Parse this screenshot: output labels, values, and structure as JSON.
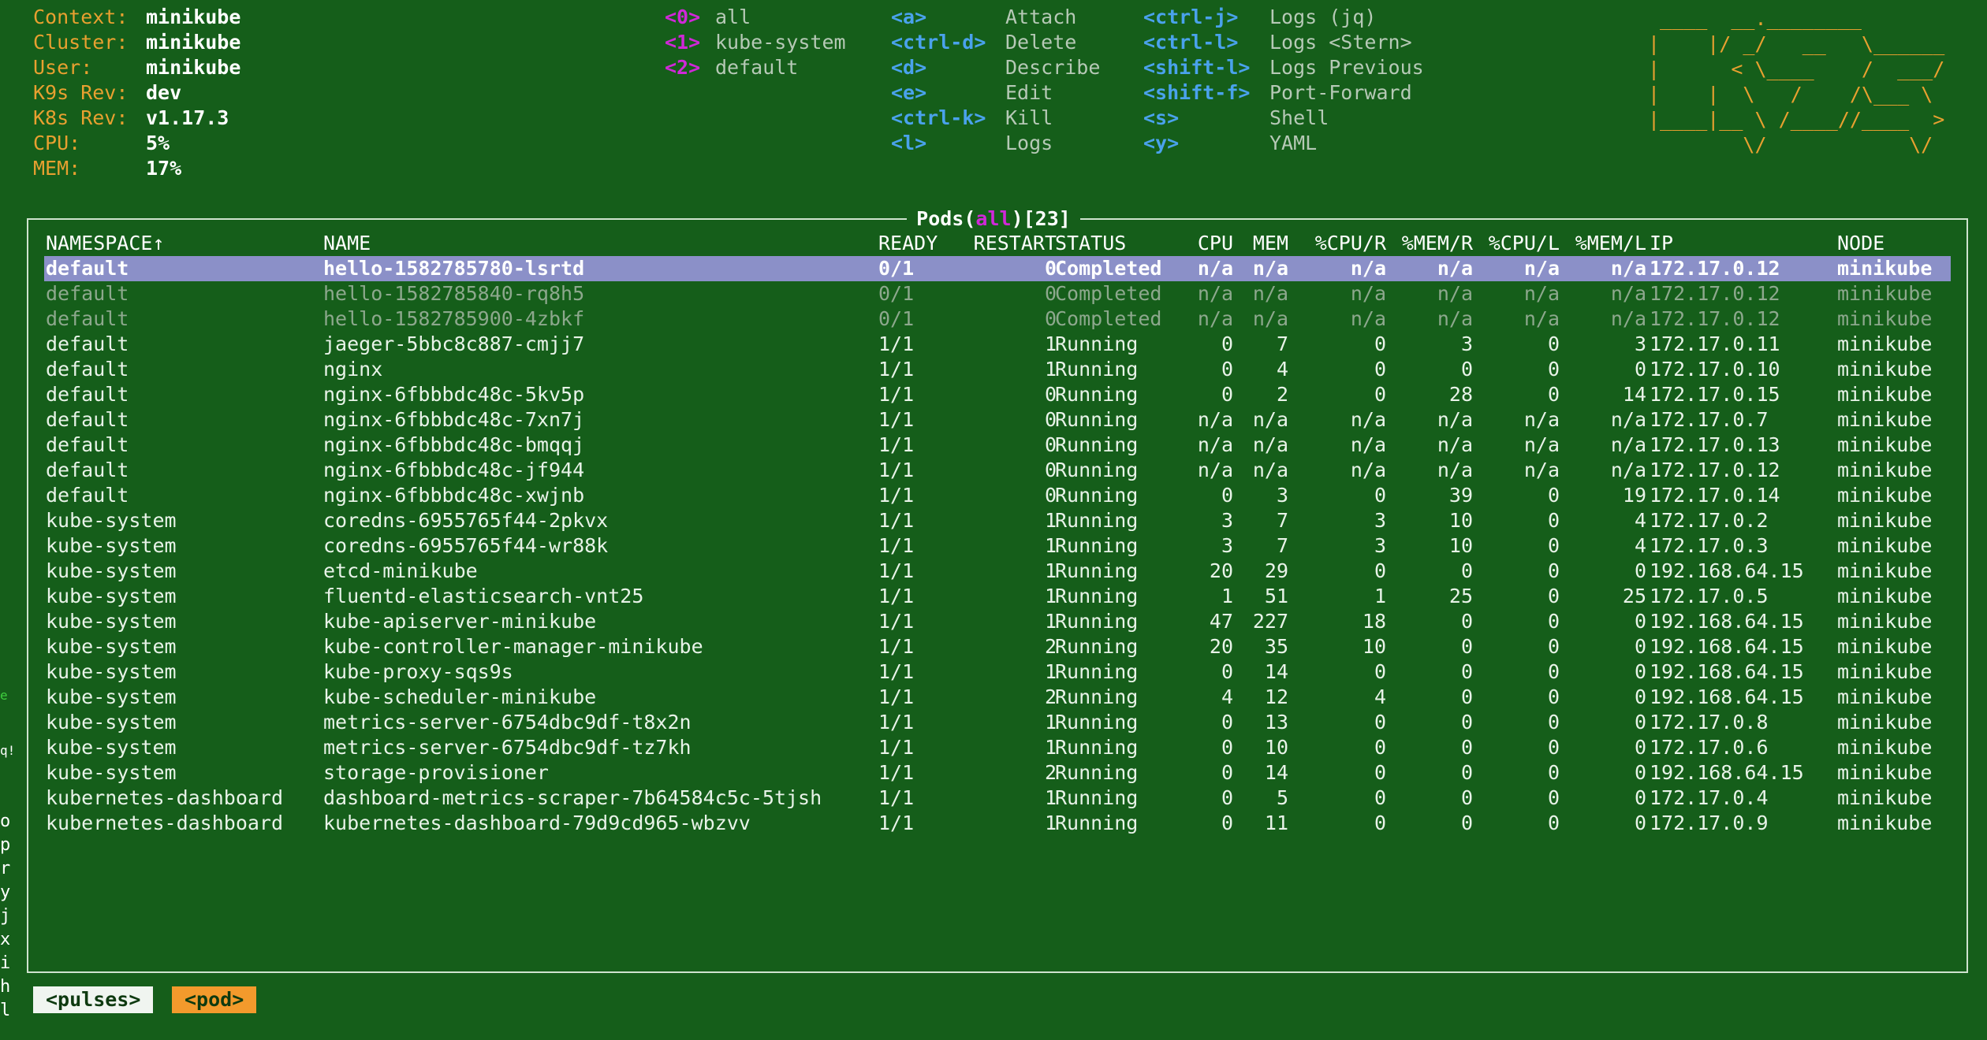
{
  "cluster_info": [
    {
      "label": "Context:",
      "value": "minikube"
    },
    {
      "label": "Cluster:",
      "value": "minikube"
    },
    {
      "label": "User:",
      "value": "minikube"
    },
    {
      "label": "K9s Rev:",
      "value": "dev"
    },
    {
      "label": "K8s Rev:",
      "value": "v1.17.3"
    },
    {
      "label": "CPU:",
      "value": "5%"
    },
    {
      "label": "MEM:",
      "value": "17%"
    }
  ],
  "namespaces": [
    {
      "key": "<0>",
      "name": "all"
    },
    {
      "key": "<1>",
      "name": "kube-system"
    },
    {
      "key": "<2>",
      "name": "default"
    }
  ],
  "shortcuts_col1": [
    {
      "key": "<a>",
      "action": "Attach"
    },
    {
      "key": "<ctrl-d>",
      "action": "Delete"
    },
    {
      "key": "<d>",
      "action": "Describe"
    },
    {
      "key": "<e>",
      "action": "Edit"
    },
    {
      "key": "<ctrl-k>",
      "action": "Kill"
    },
    {
      "key": "<l>",
      "action": "Logs"
    }
  ],
  "shortcuts_col2": [
    {
      "key": "<ctrl-j>",
      "action": "Logs (jq)"
    },
    {
      "key": "<ctrl-l>",
      "action": "Logs <Stern>"
    },
    {
      "key": "<shift-l>",
      "action": "Logs Previous"
    },
    {
      "key": "<shift-f>",
      "action": "Port-Forward"
    },
    {
      "key": "<s>",
      "action": "Shell"
    },
    {
      "key": "<y>",
      "action": "YAML"
    }
  ],
  "logo_lines": [
    " ____  __.________       ",
    "|    |/ _/   __   \\______",
    "|      < \\____    /  ___/",
    "|    |  \\   /    /\\___ \\ ",
    "|____|__ \\ /____//____  >",
    "        \\/            \\/ "
  ],
  "table": {
    "title_prefix": "Pods(",
    "title_filter": "all",
    "title_suffix": ")[23]",
    "columns": [
      "NAMESPACE↑",
      "NAME",
      "READY",
      "RESTART",
      "STATUS",
      "CPU",
      "MEM",
      "%CPU/R",
      "%MEM/R",
      "%CPU/L",
      "%MEM/L",
      "IP",
      "NODE"
    ],
    "rows": [
      [
        "default",
        "hello-1582785780-lsrtd",
        "0/1",
        "0",
        "Completed",
        "n/a",
        "n/a",
        "n/a",
        "n/a",
        "n/a",
        "n/a",
        "172.17.0.12",
        "minikube"
      ],
      [
        "default",
        "hello-1582785840-rq8h5",
        "0/1",
        "0",
        "Completed",
        "n/a",
        "n/a",
        "n/a",
        "n/a",
        "n/a",
        "n/a",
        "172.17.0.12",
        "minikube"
      ],
      [
        "default",
        "hello-1582785900-4zbkf",
        "0/1",
        "0",
        "Completed",
        "n/a",
        "n/a",
        "n/a",
        "n/a",
        "n/a",
        "n/a",
        "172.17.0.12",
        "minikube"
      ],
      [
        "default",
        "jaeger-5bbc8c887-cmjj7",
        "1/1",
        "1",
        "Running",
        "0",
        "7",
        "0",
        "3",
        "0",
        "3",
        "172.17.0.11",
        "minikube"
      ],
      [
        "default",
        "nginx",
        "1/1",
        "1",
        "Running",
        "0",
        "4",
        "0",
        "0",
        "0",
        "0",
        "172.17.0.10",
        "minikube"
      ],
      [
        "default",
        "nginx-6fbbbdc48c-5kv5p",
        "1/1",
        "0",
        "Running",
        "0",
        "2",
        "0",
        "28",
        "0",
        "14",
        "172.17.0.15",
        "minikube"
      ],
      [
        "default",
        "nginx-6fbbbdc48c-7xn7j",
        "1/1",
        "0",
        "Running",
        "n/a",
        "n/a",
        "n/a",
        "n/a",
        "n/a",
        "n/a",
        "172.17.0.7",
        "minikube"
      ],
      [
        "default",
        "nginx-6fbbbdc48c-bmqqj",
        "1/1",
        "0",
        "Running",
        "n/a",
        "n/a",
        "n/a",
        "n/a",
        "n/a",
        "n/a",
        "172.17.0.13",
        "minikube"
      ],
      [
        "default",
        "nginx-6fbbbdc48c-jf944",
        "1/1",
        "0",
        "Running",
        "n/a",
        "n/a",
        "n/a",
        "n/a",
        "n/a",
        "n/a",
        "172.17.0.12",
        "minikube"
      ],
      [
        "default",
        "nginx-6fbbbdc48c-xwjnb",
        "1/1",
        "0",
        "Running",
        "0",
        "3",
        "0",
        "39",
        "0",
        "19",
        "172.17.0.14",
        "minikube"
      ],
      [
        "kube-system",
        "coredns-6955765f44-2pkvx",
        "1/1",
        "1",
        "Running",
        "3",
        "7",
        "3",
        "10",
        "0",
        "4",
        "172.17.0.2",
        "minikube"
      ],
      [
        "kube-system",
        "coredns-6955765f44-wr88k",
        "1/1",
        "1",
        "Running",
        "3",
        "7",
        "3",
        "10",
        "0",
        "4",
        "172.17.0.3",
        "minikube"
      ],
      [
        "kube-system",
        "etcd-minikube",
        "1/1",
        "1",
        "Running",
        "20",
        "29",
        "0",
        "0",
        "0",
        "0",
        "192.168.64.15",
        "minikube"
      ],
      [
        "kube-system",
        "fluentd-elasticsearch-vnt25",
        "1/1",
        "1",
        "Running",
        "1",
        "51",
        "1",
        "25",
        "0",
        "25",
        "172.17.0.5",
        "minikube"
      ],
      [
        "kube-system",
        "kube-apiserver-minikube",
        "1/1",
        "1",
        "Running",
        "47",
        "227",
        "18",
        "0",
        "0",
        "0",
        "192.168.64.15",
        "minikube"
      ],
      [
        "kube-system",
        "kube-controller-manager-minikube",
        "1/1",
        "2",
        "Running",
        "20",
        "35",
        "10",
        "0",
        "0",
        "0",
        "192.168.64.15",
        "minikube"
      ],
      [
        "kube-system",
        "kube-proxy-sqs9s",
        "1/1",
        "1",
        "Running",
        "0",
        "14",
        "0",
        "0",
        "0",
        "0",
        "192.168.64.15",
        "minikube"
      ],
      [
        "kube-system",
        "kube-scheduler-minikube",
        "1/1",
        "2",
        "Running",
        "4",
        "12",
        "4",
        "0",
        "0",
        "0",
        "192.168.64.15",
        "minikube"
      ],
      [
        "kube-system",
        "metrics-server-6754dbc9df-t8x2n",
        "1/1",
        "1",
        "Running",
        "0",
        "13",
        "0",
        "0",
        "0",
        "0",
        "172.17.0.8",
        "minikube"
      ],
      [
        "kube-system",
        "metrics-server-6754dbc9df-tz7kh",
        "1/1",
        "1",
        "Running",
        "0",
        "10",
        "0",
        "0",
        "0",
        "0",
        "172.17.0.6",
        "minikube"
      ],
      [
        "kube-system",
        "storage-provisioner",
        "1/1",
        "2",
        "Running",
        "0",
        "14",
        "0",
        "0",
        "0",
        "0",
        "192.168.64.15",
        "minikube"
      ],
      [
        "kubernetes-dashboard",
        "dashboard-metrics-scraper-7b64584c5c-5tjsh",
        "1/1",
        "1",
        "Running",
        "0",
        "5",
        "0",
        "0",
        "0",
        "0",
        "172.17.0.4",
        "minikube"
      ],
      [
        "kubernetes-dashboard",
        "kubernetes-dashboard-79d9cd965-wbzvv",
        "1/1",
        "1",
        "Running",
        "0",
        "11",
        "0",
        "0",
        "0",
        "0",
        "172.17.0.9",
        "minikube"
      ]
    ]
  },
  "breadcrumbs": [
    "<pulses>",
    "<pod>"
  ],
  "left_strip": [
    "e",
    "q!",
    "o",
    "p",
    "r",
    "y",
    "j",
    "x",
    "i",
    "h",
    "l"
  ]
}
